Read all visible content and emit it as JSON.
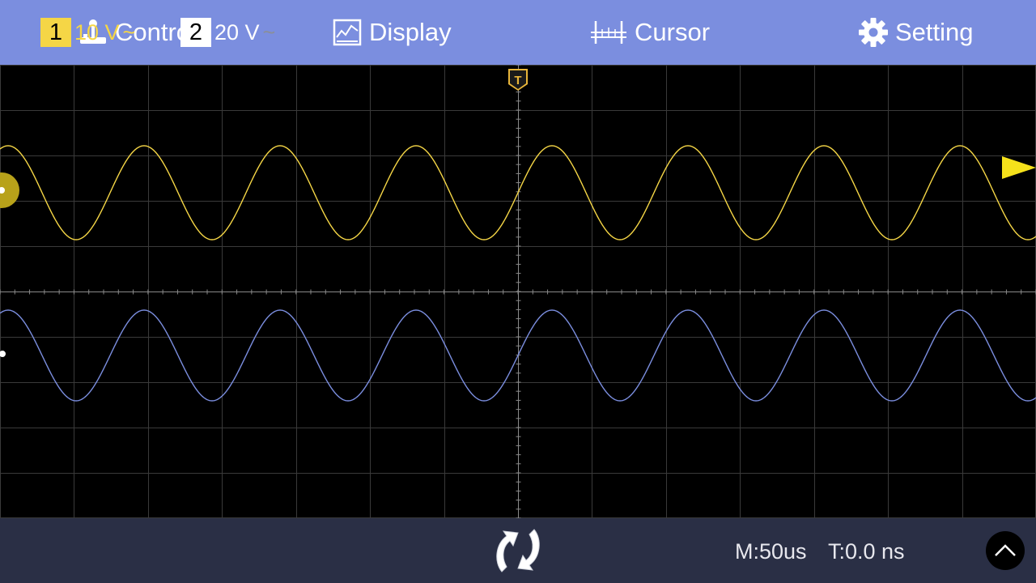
{
  "menu": {
    "control": {
      "label": "Control",
      "icon": "joystick-icon"
    },
    "display": {
      "label": "Display",
      "icon": "waveform-display-icon"
    },
    "cursor": {
      "label": "Cursor",
      "icon": "ruler-icon"
    },
    "setting": {
      "label": "Setting",
      "icon": "gear-icon"
    }
  },
  "screen": {
    "divisions": {
      "horizontal": 14,
      "vertical": 10
    },
    "trigger_marker": "T",
    "colors": {
      "background": "#000000",
      "grid": "#3a3a3a",
      "center_axis": "#8a8a8a",
      "channel1": "#f5d646",
      "channel2": "#7b8edf"
    }
  },
  "channels": [
    {
      "number": "1",
      "scale": "10 V",
      "coupling": "~",
      "color": "#f5d646"
    },
    {
      "number": "2",
      "scale": "20 V",
      "coupling": "~",
      "color": "#ffffff"
    }
  ],
  "status": {
    "timebase": "M:50us",
    "trigger_time": "T:0.0 ns"
  },
  "controls": {
    "run_stop_icon": "refresh-icon",
    "expand_icon": "chevron-up-icon"
  }
}
